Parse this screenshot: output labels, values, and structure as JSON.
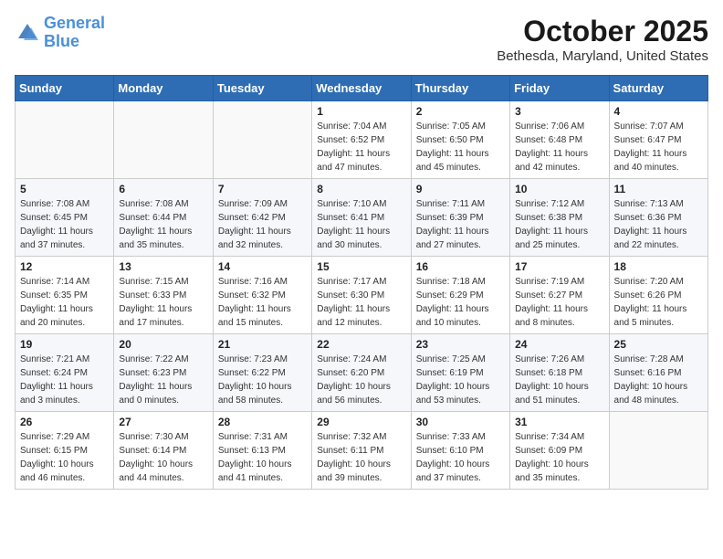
{
  "header": {
    "logo_line1": "General",
    "logo_line2": "Blue",
    "month_title": "October 2025",
    "location": "Bethesda, Maryland, United States"
  },
  "days_of_week": [
    "Sunday",
    "Monday",
    "Tuesday",
    "Wednesday",
    "Thursday",
    "Friday",
    "Saturday"
  ],
  "weeks": [
    [
      {
        "day": "",
        "info": ""
      },
      {
        "day": "",
        "info": ""
      },
      {
        "day": "",
        "info": ""
      },
      {
        "day": "1",
        "info": "Sunrise: 7:04 AM\nSunset: 6:52 PM\nDaylight: 11 hours\nand 47 minutes."
      },
      {
        "day": "2",
        "info": "Sunrise: 7:05 AM\nSunset: 6:50 PM\nDaylight: 11 hours\nand 45 minutes."
      },
      {
        "day": "3",
        "info": "Sunrise: 7:06 AM\nSunset: 6:48 PM\nDaylight: 11 hours\nand 42 minutes."
      },
      {
        "day": "4",
        "info": "Sunrise: 7:07 AM\nSunset: 6:47 PM\nDaylight: 11 hours\nand 40 minutes."
      }
    ],
    [
      {
        "day": "5",
        "info": "Sunrise: 7:08 AM\nSunset: 6:45 PM\nDaylight: 11 hours\nand 37 minutes."
      },
      {
        "day": "6",
        "info": "Sunrise: 7:08 AM\nSunset: 6:44 PM\nDaylight: 11 hours\nand 35 minutes."
      },
      {
        "day": "7",
        "info": "Sunrise: 7:09 AM\nSunset: 6:42 PM\nDaylight: 11 hours\nand 32 minutes."
      },
      {
        "day": "8",
        "info": "Sunrise: 7:10 AM\nSunset: 6:41 PM\nDaylight: 11 hours\nand 30 minutes."
      },
      {
        "day": "9",
        "info": "Sunrise: 7:11 AM\nSunset: 6:39 PM\nDaylight: 11 hours\nand 27 minutes."
      },
      {
        "day": "10",
        "info": "Sunrise: 7:12 AM\nSunset: 6:38 PM\nDaylight: 11 hours\nand 25 minutes."
      },
      {
        "day": "11",
        "info": "Sunrise: 7:13 AM\nSunset: 6:36 PM\nDaylight: 11 hours\nand 22 minutes."
      }
    ],
    [
      {
        "day": "12",
        "info": "Sunrise: 7:14 AM\nSunset: 6:35 PM\nDaylight: 11 hours\nand 20 minutes."
      },
      {
        "day": "13",
        "info": "Sunrise: 7:15 AM\nSunset: 6:33 PM\nDaylight: 11 hours\nand 17 minutes."
      },
      {
        "day": "14",
        "info": "Sunrise: 7:16 AM\nSunset: 6:32 PM\nDaylight: 11 hours\nand 15 minutes."
      },
      {
        "day": "15",
        "info": "Sunrise: 7:17 AM\nSunset: 6:30 PM\nDaylight: 11 hours\nand 12 minutes."
      },
      {
        "day": "16",
        "info": "Sunrise: 7:18 AM\nSunset: 6:29 PM\nDaylight: 11 hours\nand 10 minutes."
      },
      {
        "day": "17",
        "info": "Sunrise: 7:19 AM\nSunset: 6:27 PM\nDaylight: 11 hours\nand 8 minutes."
      },
      {
        "day": "18",
        "info": "Sunrise: 7:20 AM\nSunset: 6:26 PM\nDaylight: 11 hours\nand 5 minutes."
      }
    ],
    [
      {
        "day": "19",
        "info": "Sunrise: 7:21 AM\nSunset: 6:24 PM\nDaylight: 11 hours\nand 3 minutes."
      },
      {
        "day": "20",
        "info": "Sunrise: 7:22 AM\nSunset: 6:23 PM\nDaylight: 11 hours\nand 0 minutes."
      },
      {
        "day": "21",
        "info": "Sunrise: 7:23 AM\nSunset: 6:22 PM\nDaylight: 10 hours\nand 58 minutes."
      },
      {
        "day": "22",
        "info": "Sunrise: 7:24 AM\nSunset: 6:20 PM\nDaylight: 10 hours\nand 56 minutes."
      },
      {
        "day": "23",
        "info": "Sunrise: 7:25 AM\nSunset: 6:19 PM\nDaylight: 10 hours\nand 53 minutes."
      },
      {
        "day": "24",
        "info": "Sunrise: 7:26 AM\nSunset: 6:18 PM\nDaylight: 10 hours\nand 51 minutes."
      },
      {
        "day": "25",
        "info": "Sunrise: 7:28 AM\nSunset: 6:16 PM\nDaylight: 10 hours\nand 48 minutes."
      }
    ],
    [
      {
        "day": "26",
        "info": "Sunrise: 7:29 AM\nSunset: 6:15 PM\nDaylight: 10 hours\nand 46 minutes."
      },
      {
        "day": "27",
        "info": "Sunrise: 7:30 AM\nSunset: 6:14 PM\nDaylight: 10 hours\nand 44 minutes."
      },
      {
        "day": "28",
        "info": "Sunrise: 7:31 AM\nSunset: 6:13 PM\nDaylight: 10 hours\nand 41 minutes."
      },
      {
        "day": "29",
        "info": "Sunrise: 7:32 AM\nSunset: 6:11 PM\nDaylight: 10 hours\nand 39 minutes."
      },
      {
        "day": "30",
        "info": "Sunrise: 7:33 AM\nSunset: 6:10 PM\nDaylight: 10 hours\nand 37 minutes."
      },
      {
        "day": "31",
        "info": "Sunrise: 7:34 AM\nSunset: 6:09 PM\nDaylight: 10 hours\nand 35 minutes."
      },
      {
        "day": "",
        "info": ""
      }
    ]
  ]
}
